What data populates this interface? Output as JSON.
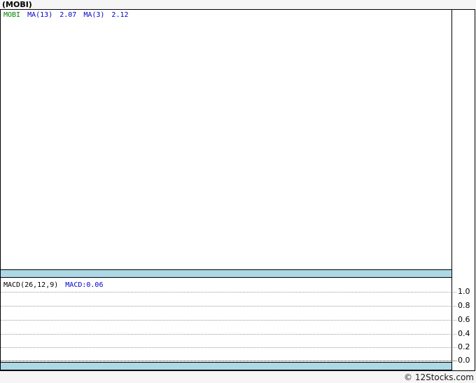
{
  "header": {
    "title": "(MOBI)"
  },
  "price_panel": {
    "legend": {
      "symbol": "MOBI",
      "ma13_label": "MA(13)",
      "ma13_value": "2.07",
      "ma3_label": "MA(3)",
      "ma3_value": "2.12"
    }
  },
  "macd_panel": {
    "indicator_label": "MACD(26,12,9)",
    "indicator_value": "MACD:0.06",
    "yticks": [
      "1.0",
      "0.8",
      "0.6",
      "0.4",
      "0.2",
      "0.0"
    ]
  },
  "footer": {
    "credit": "© 12Stocks.com"
  },
  "colors": {
    "band_blue": "#ADD8E6",
    "symbol_text_green": "#008000",
    "indicator_text_blue": "#0000CC",
    "grid_gray": "#999999",
    "grid_zero_dark": "#333333",
    "border_black": "#000000",
    "page_background": "#F5F5F5"
  },
  "chart_data": [
    {
      "type": "line",
      "title": "(MOBI)",
      "series": [
        {
          "name": "MOBI",
          "color": "#008000",
          "values": []
        },
        {
          "name": "MA(13)",
          "color": "#0000CC",
          "last_value": 2.07,
          "values": []
        },
        {
          "name": "MA(3)",
          "color": "#0000CC",
          "last_value": 2.12,
          "values": []
        }
      ],
      "legend_position": "top-left",
      "note": "price panel is rendered empty (no visible plotted points)"
    },
    {
      "type": "line",
      "title": "MACD(26,12,9)",
      "series": [
        {
          "name": "MACD",
          "last_value": 0.06,
          "values": []
        }
      ],
      "ylim": [
        0.0,
        1.0
      ],
      "yticks": [
        1.0,
        0.8,
        0.6,
        0.4,
        0.2,
        0.0
      ],
      "grid": true,
      "legend_position": "top-left"
    }
  ]
}
